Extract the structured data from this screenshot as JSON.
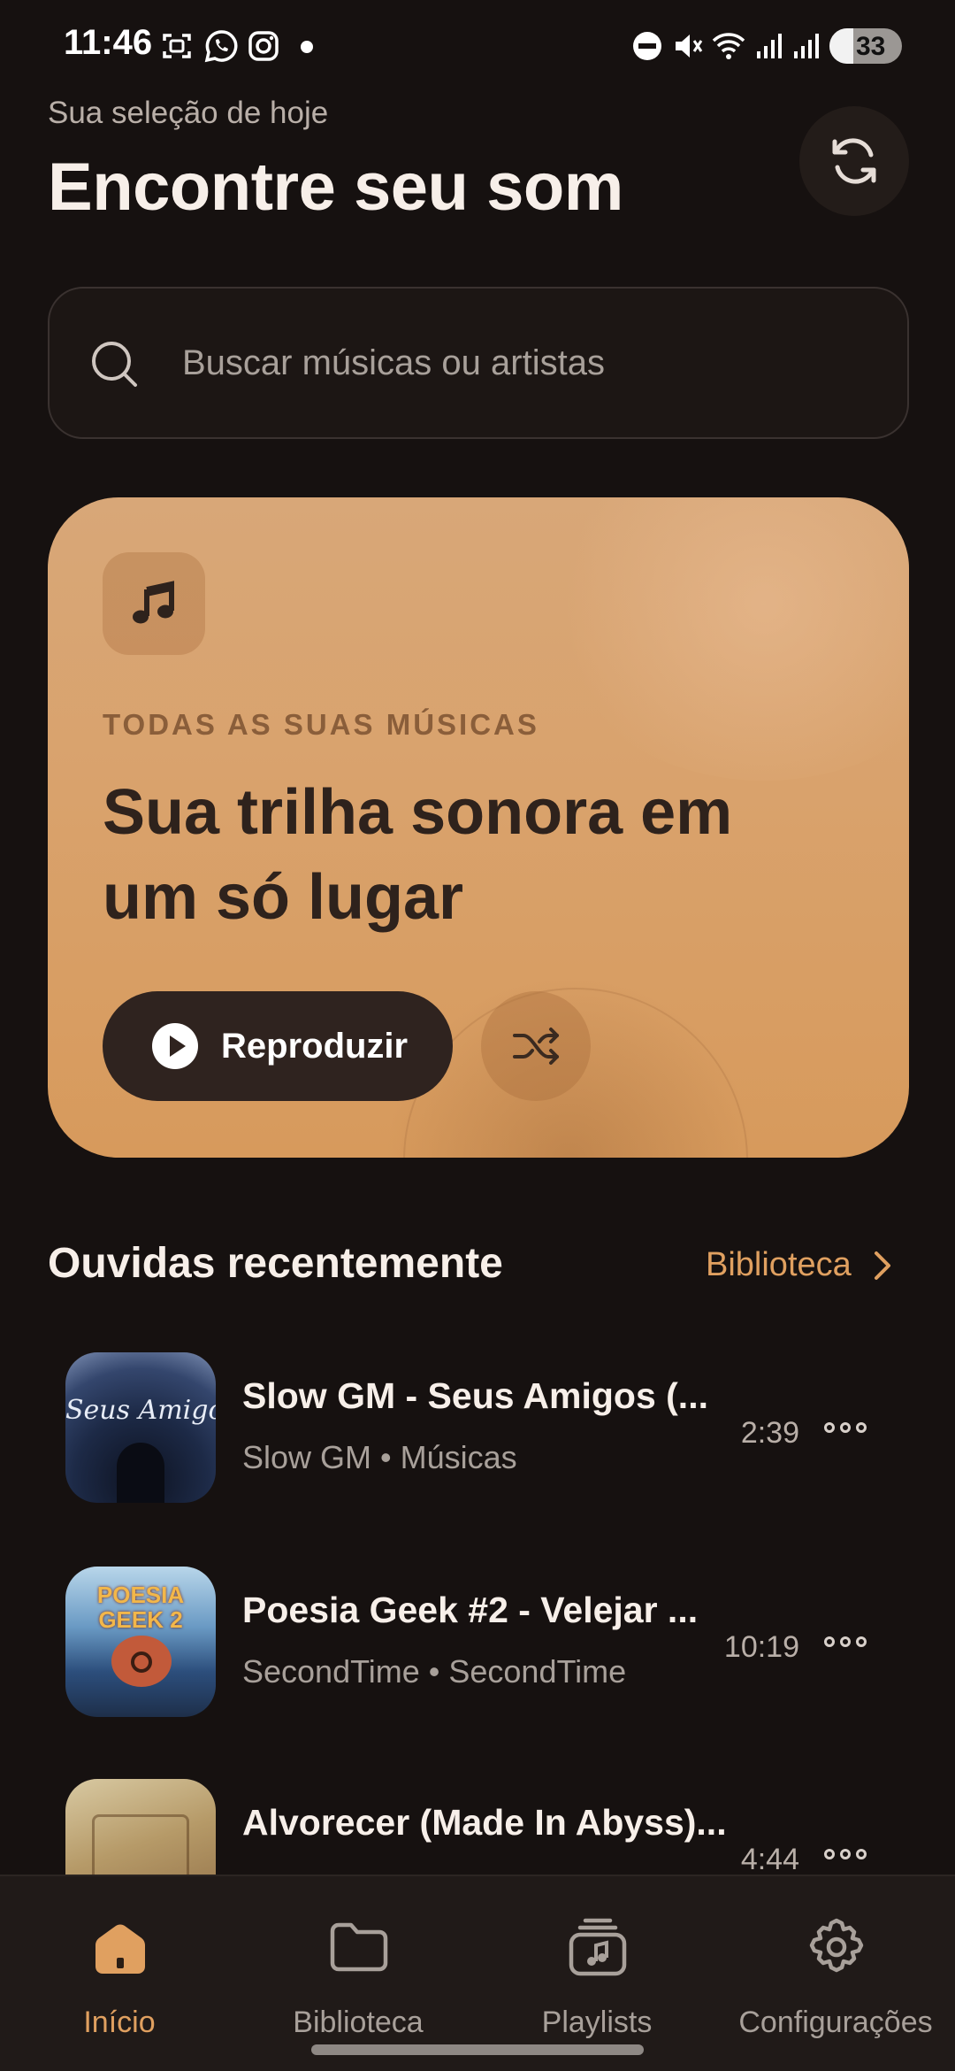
{
  "status_bar": {
    "time": "11:46",
    "battery": "33",
    "battery_level": 0.33,
    "icons": [
      "screenshot-icon",
      "whatsapp-icon",
      "instagram-icon",
      "notification-dot",
      "dnd-icon",
      "mute-icon",
      "wifi-icon",
      "signal-icon",
      "signal-icon",
      "battery-icon"
    ]
  },
  "header": {
    "subtitle": "Sua seleção de hoje",
    "title": "Encontre seu som",
    "refresh_icon": "refresh-icon"
  },
  "search": {
    "placeholder": "Buscar músicas ou artistas",
    "value": ""
  },
  "hero": {
    "icon": "music-note-icon",
    "eyebrow": "TODAS AS SUAS MÚSICAS",
    "heading": "Sua trilha sonora em um só lugar",
    "play_label": "Reproduzir",
    "shuffle_icon": "shuffle-icon"
  },
  "recent": {
    "title": "Ouvidas recentemente",
    "link_label": "Biblioteca",
    "tracks": [
      {
        "title": "Slow GM - Seus Amigos (...",
        "subtitle": "Slow GM • Músicas",
        "duration": "2:39",
        "cover_text": "Seus Amigos"
      },
      {
        "title": "Poesia Geek #2 - Velejar ...",
        "subtitle": "SecondTime • SecondTime",
        "duration": "10:19",
        "cover_text": "POESIA GEEK 2"
      },
      {
        "title": "Alvorecer (Made In Abyss)...",
        "subtitle": "",
        "duration": "4:44",
        "cover_text": ""
      }
    ]
  },
  "nav": {
    "items": [
      {
        "label": "Início",
        "icon": "home-icon",
        "active": true
      },
      {
        "label": "Biblioteca",
        "icon": "folder-icon",
        "active": false
      },
      {
        "label": "Playlists",
        "icon": "playlist-icon",
        "active": false
      },
      {
        "label": "Configurações",
        "icon": "gear-icon",
        "active": false
      }
    ]
  },
  "colors": {
    "background": "#161110",
    "accent": "#e0a060",
    "hero": "#d9a26c",
    "play_button": "#2f231f"
  }
}
